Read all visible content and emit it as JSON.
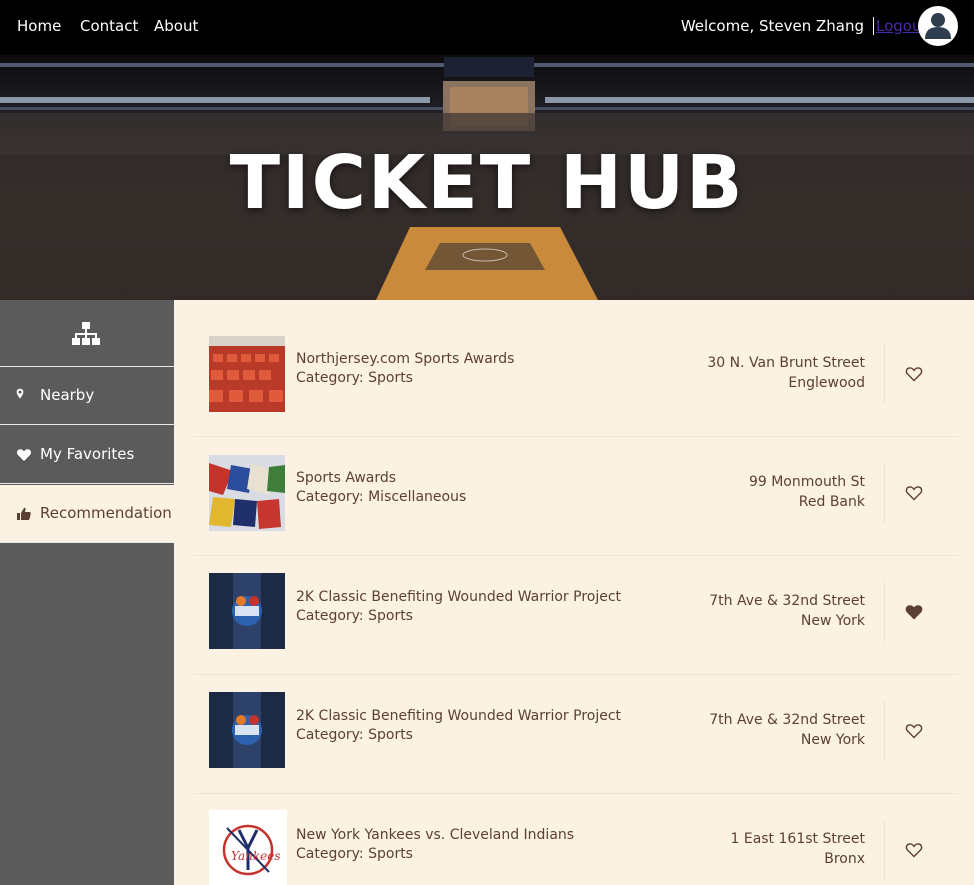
{
  "nav": {
    "links": [
      "Home",
      "Contact",
      "About"
    ],
    "welcome": "Welcome, Steven Zhang",
    "logout": "Logout",
    "avatar_icon": "user-icon"
  },
  "hero": {
    "title": "TICKET HUB"
  },
  "sidebar": {
    "top_icon": "sitemap-icon",
    "items": [
      {
        "label": "Nearby",
        "icon": "map-marker-icon"
      },
      {
        "label": "My Favorites",
        "icon": "heart-icon"
      },
      {
        "label": "Recommendation",
        "icon": "thumbs-up-icon",
        "active": true
      }
    ]
  },
  "items": [
    {
      "title": "Northjersey.com Sports Awards",
      "category": "Category: Sports",
      "address1": "30 N. Van Brunt Street",
      "address2": "Englewood",
      "favorite": false,
      "thumb": "stadium-seats"
    },
    {
      "title": "Sports Awards",
      "category": "Category: Miscellaneous",
      "address1": "99 Monmouth St",
      "address2": "Red Bank",
      "favorite": false,
      "thumb": "flags"
    },
    {
      "title": "2K Classic Benefiting Wounded Warrior Project",
      "category": "Category: Sports",
      "address1": "7th Ave & 32nd Street",
      "address2": "New York",
      "favorite": true,
      "thumb": "2k-classic-logo"
    },
    {
      "title": "2K Classic Benefiting Wounded Warrior Project",
      "category": "Category: Sports",
      "address1": "7th Ave & 32nd Street",
      "address2": "New York",
      "favorite": false,
      "thumb": "2k-classic-logo"
    },
    {
      "title": "New York Yankees vs. Cleveland Indians",
      "category": "Category: Sports",
      "address1": "1 East 161st Street",
      "address2": "Bronx",
      "favorite": false,
      "thumb": "yankees-logo"
    }
  ],
  "colors": {
    "accent": "#5c4033",
    "background": "#fcf2e3",
    "sidebar": "#5b5b5b",
    "nav": "#000000"
  }
}
